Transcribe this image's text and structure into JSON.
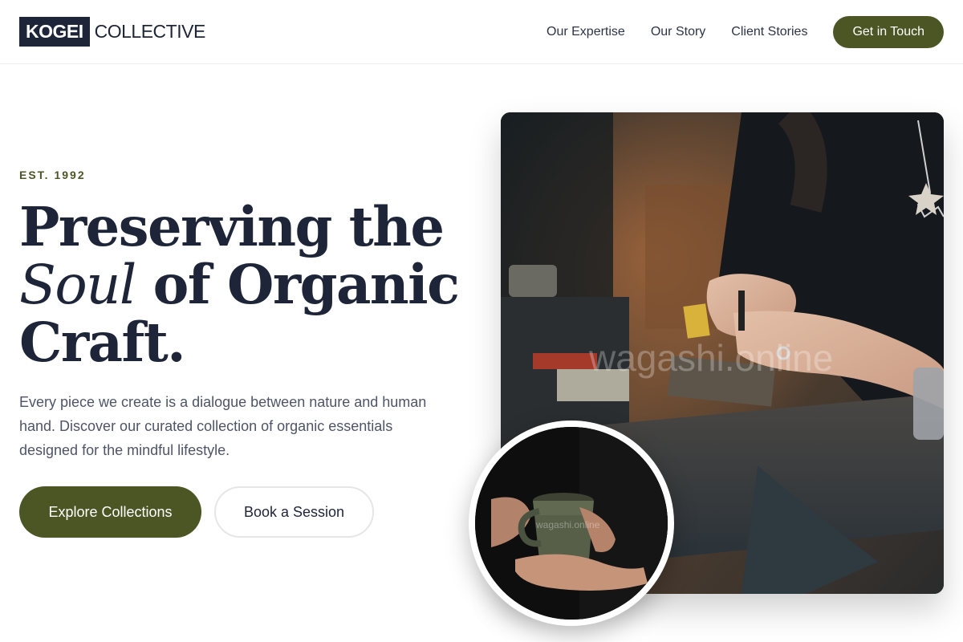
{
  "brand": {
    "logo_box": "KOGEI",
    "logo_word": "COLLECTIVE"
  },
  "nav": {
    "links": [
      "Our Expertise",
      "Our Story",
      "Client Stories"
    ],
    "cta": "Get in Touch"
  },
  "hero": {
    "eyebrow": "EST. 1992",
    "headline_line1": "Preserving the",
    "headline_soul": "Soul",
    "headline_line2_rest": " of Organic",
    "headline_line3": "Craft.",
    "body": "Every piece we create is a dialogue between nature and human hand. Discover our curated collection of organic essentials designed for the mindful lifestyle.",
    "primary_button": "Explore Collections",
    "secondary_button": "Book a Session"
  },
  "images": {
    "main": "craftsperson-working-at-anvil-photo",
    "inset": "hands-holding-ceramic-mug-photo",
    "watermark_main": "wagashi.online",
    "watermark_inset": "wagashi.online"
  },
  "colors": {
    "navy": "#1e2538",
    "olive": "#4c5524",
    "body_text": "#4e5568"
  }
}
